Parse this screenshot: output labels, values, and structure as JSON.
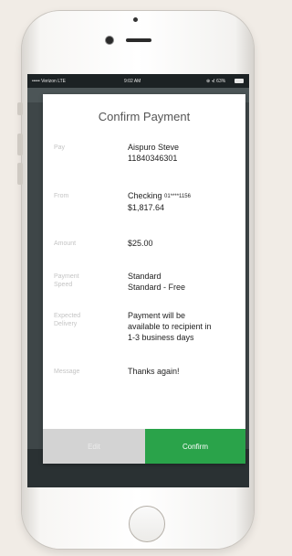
{
  "status_bar": {
    "carrier": "••••• Verizon LTE",
    "time": "9:02 AM",
    "indicators": "⊕ ⊀ 63%",
    "battery": "battery-icon"
  },
  "modal": {
    "title": "Confirm Payment",
    "rows": [
      {
        "label": "Pay",
        "value_lines": [
          "Aispuro Steve",
          "11840346301"
        ]
      },
      {
        "label": "From",
        "account": "Checking",
        "account_mask": "01****1156",
        "balance": "$1,817.64"
      },
      {
        "label": "Amount",
        "value_lines": [
          "$25.00"
        ]
      },
      {
        "label": "Payment Speed",
        "value_lines": [
          "Standard",
          "Standard - Free"
        ]
      },
      {
        "label": "Expected Delivery",
        "value_lines": [
          "Payment will be",
          "available to recipient in",
          "1-3 business days"
        ]
      },
      {
        "label": "Message",
        "value_lines": [
          "Thanks again!"
        ]
      }
    ],
    "edit_label": "Edit",
    "confirm_label": "Confirm"
  },
  "colors": {
    "confirm": "#2aa34a",
    "edit": "#d3d3d3",
    "dim_bg": "#3e4648"
  }
}
